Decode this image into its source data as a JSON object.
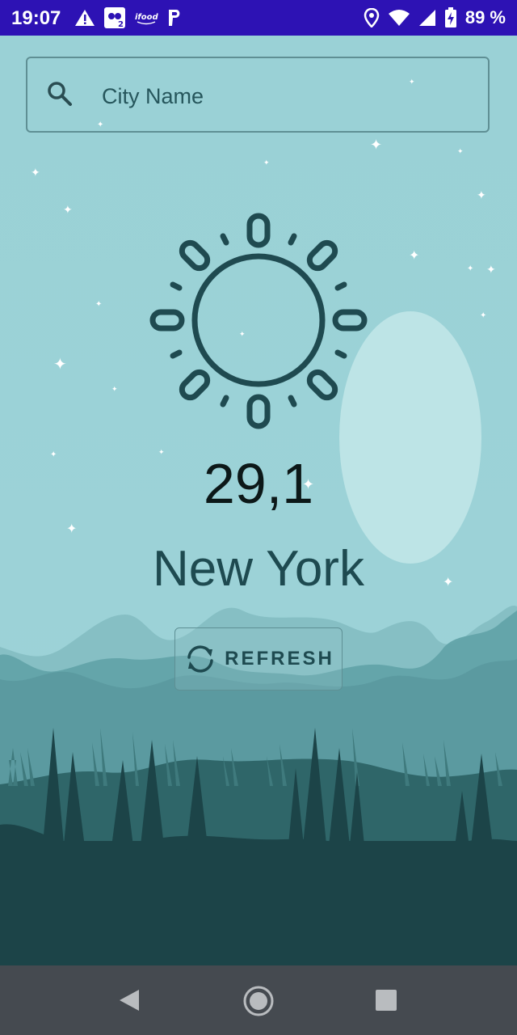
{
  "status_bar": {
    "time": "19:07",
    "battery": "89 %",
    "left_icons": [
      "warning-icon",
      "sim-card-icon",
      "ifood-icon",
      "paypal-icon"
    ],
    "right_icons": [
      "location-icon",
      "wifi-icon",
      "signal-icon",
      "battery-charging-icon"
    ]
  },
  "search": {
    "placeholder": "City Name"
  },
  "weather": {
    "icon": "sun-icon",
    "temperature": "29,1",
    "city": "New York"
  },
  "refresh_button": {
    "label": "REFRESH"
  },
  "nav": {
    "buttons": [
      "back",
      "home",
      "recents"
    ]
  },
  "colors": {
    "status_bar": "#2d12b4",
    "sky": "#9dd2d7",
    "moon": "#bde4e6",
    "icon_dark": "#1e4a50",
    "mountain_far": "#86bfc4",
    "mountain_mid": "#62a3a9",
    "forest_mid": "#2f6669",
    "forest_dark": "#1c4448",
    "nav_bar": "#454a50"
  }
}
